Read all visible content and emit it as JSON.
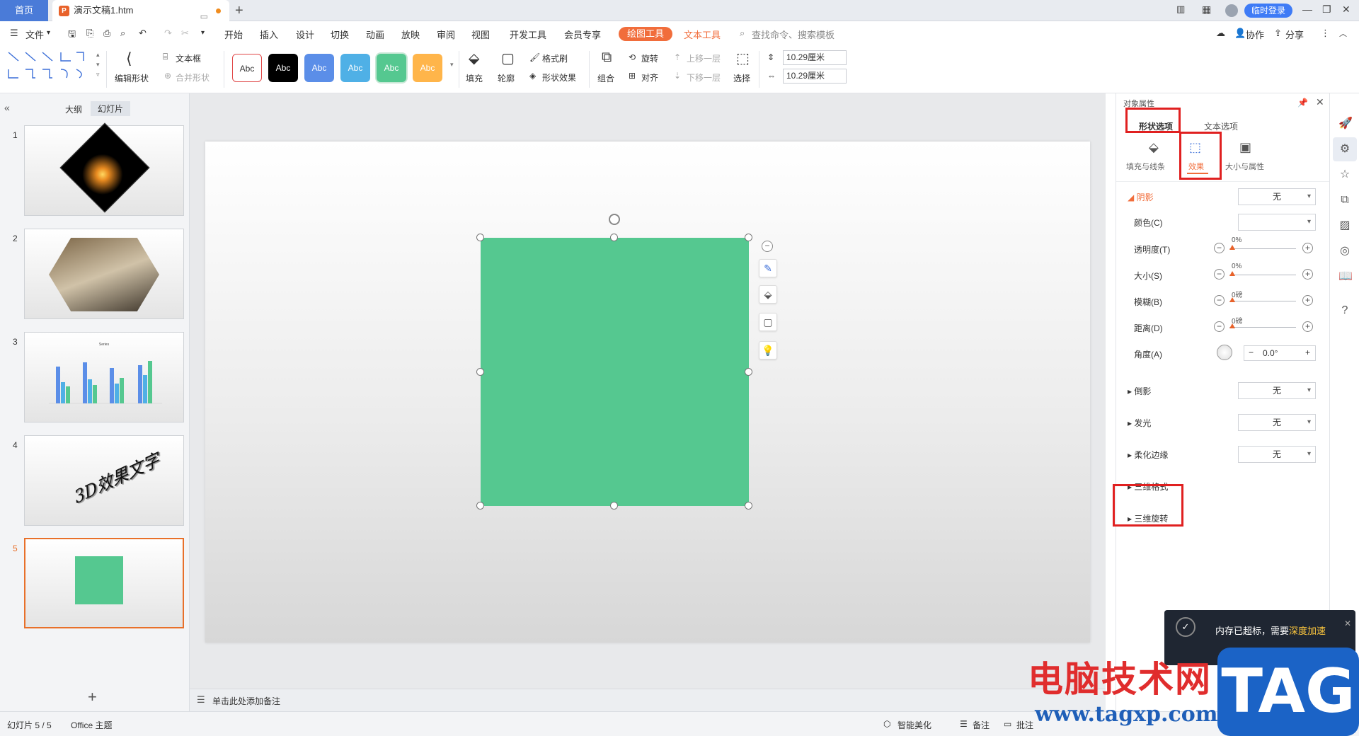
{
  "titlebar": {
    "home_tab": "首页",
    "doc_tab": "演示文稿1.htm",
    "doc_icon": "P",
    "login": "临时登录"
  },
  "menu": {
    "file": "文件",
    "items": [
      "开始",
      "插入",
      "设计",
      "切换",
      "动画",
      "放映",
      "审阅",
      "视图",
      "开发工具",
      "会员专享"
    ],
    "drawing_tools": "绘图工具",
    "text_tools": "文本工具",
    "search_placeholder": "查找命令、搜索模板",
    "collab": "协作",
    "share": "分享"
  },
  "ribbon": {
    "edit_shape": "编辑形状",
    "textbox": "文本框",
    "merge_shape": "合并形状",
    "styles": [
      "Abc",
      "Abc",
      "Abc",
      "Abc",
      "Abc",
      "Abc"
    ],
    "style_colors": [
      "#ffffff",
      "#000000",
      "#5b8ee8",
      "#4fb0e6",
      "#55c890",
      "#ffb54a"
    ],
    "fill": "填充",
    "outline": "轮廓",
    "format_painter": "格式刷",
    "shape_effect": "形状效果",
    "combine": "组合",
    "rotate": "旋转",
    "align": "对齐",
    "bring_forward": "上移一层",
    "send_backward": "下移一层",
    "select": "选择",
    "height": "10.29厘米",
    "width": "10.29厘米"
  },
  "left_panel": {
    "tab_outline": "大纲",
    "tab_slides": "幻灯片",
    "slide_numbers": [
      "1",
      "2",
      "3",
      "4",
      "5"
    ],
    "slide4_text": "3D效果文字",
    "chart_title": "Series"
  },
  "notes": {
    "placeholder": "单击此处添加备注"
  },
  "right_panel": {
    "title": "对象属性",
    "tab_shape": "形状选项",
    "tab_text": "文本选项",
    "sub_fill": "填充与线条",
    "sub_effect": "效果",
    "sub_size": "大小与属性",
    "shadow": "阴影",
    "shadow_value": "无",
    "color": "颜色(C)",
    "transparency": "透明度(T)",
    "transparency_value": "0%",
    "size": "大小(S)",
    "size_value": "0%",
    "blur": "模糊(B)",
    "blur_value": "0磅",
    "distance": "距离(D)",
    "distance_value": "0磅",
    "angle": "角度(A)",
    "angle_value": "0.0°",
    "reflection": "倒影",
    "reflection_value": "无",
    "glow": "发光",
    "glow_value": "无",
    "soft_edge": "柔化边缘",
    "soft_edge_value": "无",
    "format_3d": "三维格式",
    "rotation_3d": "三维旋转"
  },
  "statusbar": {
    "slide_info": "幻灯片 5 / 5",
    "theme": "Office 主题",
    "beautify": "智能美化",
    "notes": "备注",
    "comments": "批注"
  },
  "popup": {
    "message": "内存已超标，需要",
    "link": "深度加速"
  },
  "watermark": {
    "site_name": "电脑技术网",
    "url": "www.tagxp.com",
    "logo": "TAG"
  },
  "colors": {
    "accent_orange": "#f16d3b",
    "shape_green": "#55c890",
    "highlight_red": "#e02020",
    "primary_blue": "#3e7bf6"
  }
}
